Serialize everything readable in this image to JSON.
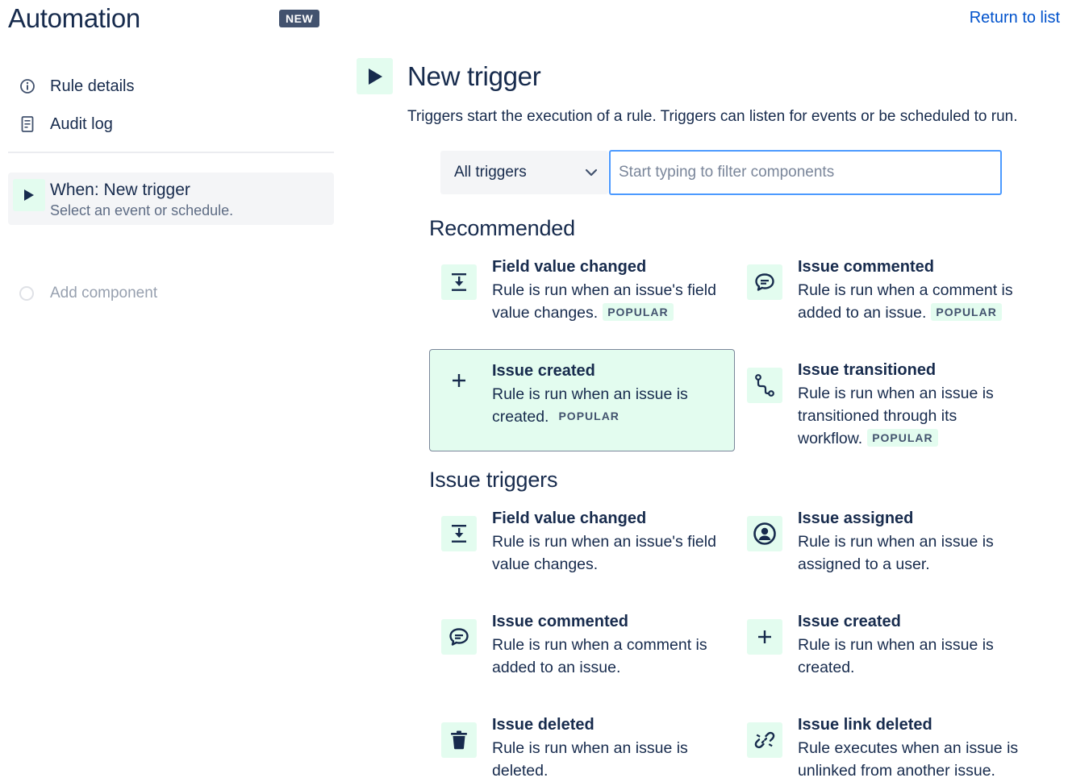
{
  "header": {
    "app_title": "Automation",
    "new_badge": "NEW",
    "return_link": "Return to list"
  },
  "sidebar": {
    "items": [
      {
        "label": "Rule details",
        "icon": "info-icon"
      },
      {
        "label": "Audit log",
        "icon": "document-icon"
      }
    ],
    "trigger": {
      "title": "When: New trigger",
      "subtitle": "Select an event or schedule."
    },
    "add_component": "Add component"
  },
  "main": {
    "title": "New trigger",
    "description": "Triggers start the execution of a rule. Triggers can listen for events or be scheduled to run.",
    "filter_select": "All triggers",
    "filter_placeholder": "Start typing to filter components",
    "popular_label": "POPULAR",
    "sections": [
      {
        "title": "Recommended",
        "components": [
          {
            "title": "Field value changed",
            "description": "Rule is run when an issue's field value changes.",
            "popular": true,
            "icon": "field-change-icon"
          },
          {
            "title": "Issue commented",
            "description": "Rule is run when a comment is added to an issue.",
            "popular": true,
            "icon": "comment-icon"
          },
          {
            "title": "Issue created",
            "description": "Rule is run when an issue is created.",
            "popular": true,
            "icon": "plus-icon",
            "selected": true
          },
          {
            "title": "Issue transitioned",
            "description": "Rule is run when an issue is transitioned through its workflow.",
            "popular": true,
            "icon": "transition-icon"
          }
        ]
      },
      {
        "title": "Issue triggers",
        "components": [
          {
            "title": "Field value changed",
            "description": "Rule is run when an issue's field value changes.",
            "icon": "field-change-icon"
          },
          {
            "title": "Issue assigned",
            "description": "Rule is run when an issue is assigned to a user.",
            "icon": "user-avatar-icon"
          },
          {
            "title": "Issue commented",
            "description": "Rule is run when a comment is added to an issue.",
            "icon": "comment-icon"
          },
          {
            "title": "Issue created",
            "description": "Rule is run when an issue is created.",
            "icon": "plus-icon"
          },
          {
            "title": "Issue deleted",
            "description": "Rule is run when an issue is deleted.",
            "icon": "trash-icon"
          },
          {
            "title": "Issue link deleted",
            "description": "Rule executes when an issue is unlinked from another issue.",
            "icon": "unlink-icon"
          }
        ]
      }
    ]
  },
  "colors": {
    "text": "#172b4d",
    "link": "#0052cc",
    "icon_bg": "#e3fcef",
    "focus_border": "#4c9aff"
  }
}
